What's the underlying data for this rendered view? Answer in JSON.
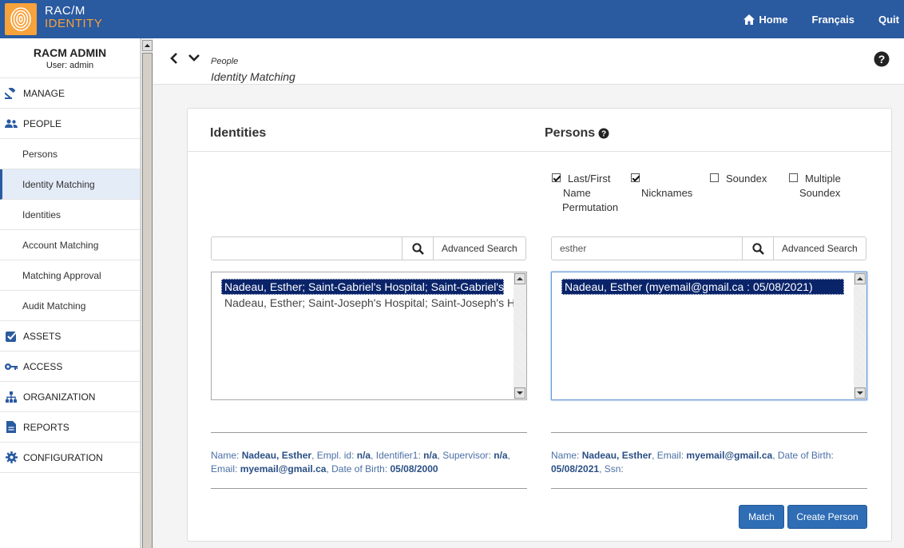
{
  "brand": {
    "line1": "RAC/M",
    "line2": "IDENTITY"
  },
  "topnav": {
    "home": "Home",
    "language": "Français",
    "quit": "Quit"
  },
  "user": {
    "name": "RACM ADMIN",
    "role": "User: admin"
  },
  "sidebar": {
    "items": [
      {
        "label": "MANAGE"
      },
      {
        "label": "PEOPLE"
      },
      {
        "label": "Persons"
      },
      {
        "label": "Identity Matching"
      },
      {
        "label": "Identities"
      },
      {
        "label": "Account Matching"
      },
      {
        "label": "Matching Approval"
      },
      {
        "label": "Audit Matching"
      },
      {
        "label": "ASSETS"
      },
      {
        "label": "ACCESS"
      },
      {
        "label": "ORGANIZATION"
      },
      {
        "label": "REPORTS"
      },
      {
        "label": "CONFIGURATION"
      }
    ]
  },
  "breadcrumb": {
    "section": "People",
    "page": "Identity Matching"
  },
  "identities": {
    "title": "Identities",
    "search_value": "",
    "advanced": "Advanced Search",
    "options": [
      "Nadeau, Esther; Saint-Gabriel's Hospital; Saint-Gabriel's Hospital",
      "Nadeau, Esther; Saint-Joseph's Hospital; Saint-Joseph's Hospital"
    ],
    "details": {
      "name_label": "Name:",
      "name": "Nadeau, Esther",
      "empl_label": "Empl. id:",
      "empl": "n/a",
      "ident_label": "Identifier1:",
      "ident": "n/a",
      "sup_label": "Supervisor:",
      "sup": "n/a",
      "email_label": "Email:",
      "email": "myemail@gmail.ca",
      "dob_label": "Date of Birth:",
      "dob": "05/08/2000"
    }
  },
  "persons": {
    "title": "Persons",
    "search_value": "esther",
    "advanced": "Advanced Search",
    "options": [
      "Nadeau, Esther (myemail@gmail.ca : 05/08/2021)"
    ],
    "checkboxes": {
      "last_first": {
        "label": [
          "Last/First",
          "Name",
          "Permutation"
        ],
        "checked": true
      },
      "nicknames": {
        "label": "Nicknames",
        "checked": true
      },
      "soundex": {
        "label": "Soundex",
        "checked": false
      },
      "multiple_soundex": {
        "label": [
          "Multiple",
          "Soundex"
        ],
        "checked": false
      }
    },
    "details": {
      "name_label": "Name:",
      "name": "Nadeau, Esther",
      "email_label": "Email:",
      "email": "myemail@gmail.ca",
      "dob_label": "Date of Birth:",
      "dob": "05/08/2021",
      "ssn_label": "Ssn:"
    }
  },
  "actions": {
    "match": "Match",
    "create": "Create Person"
  }
}
